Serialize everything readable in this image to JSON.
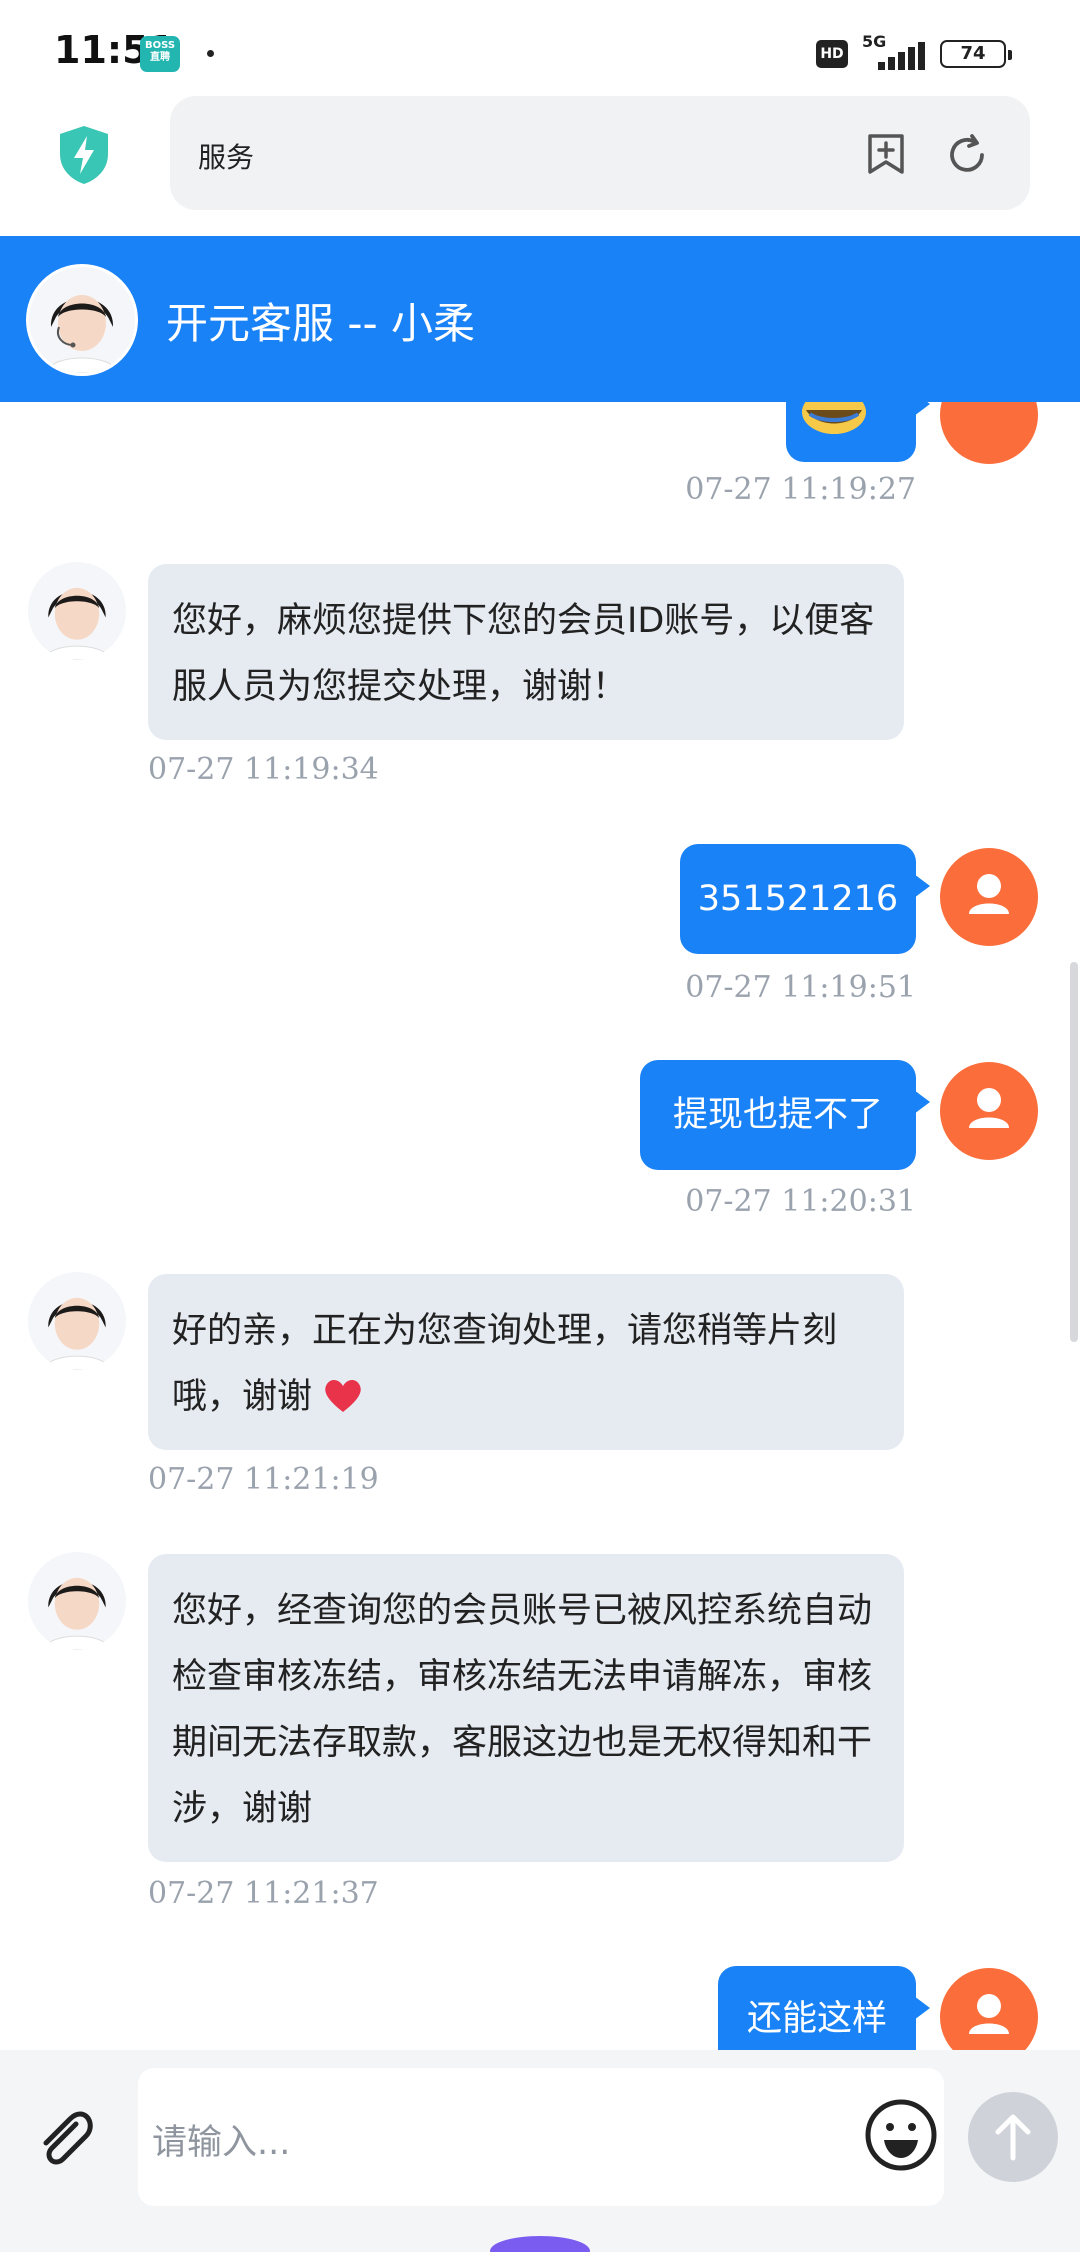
{
  "status_bar": {
    "time": "11:51",
    "app_badge": "BOSS\n直聘",
    "hd": "HD",
    "network": "5G",
    "battery": "74"
  },
  "browser": {
    "url_text": "服务"
  },
  "chat": {
    "title": "开元客服 -- 小柔"
  },
  "messages": [
    {
      "side": "out",
      "text": "",
      "time": "07-27 11:19:27"
    },
    {
      "side": "in",
      "text": "您好，麻烦您提供下您的会员ID账号，以便客服人员为您提交处理，谢谢！",
      "time": "07-27 11:19:34"
    },
    {
      "side": "out",
      "text": "351521216",
      "time": "07-27 11:19:51"
    },
    {
      "side": "out",
      "text": "提现也提不了",
      "time": "07-27 11:20:31"
    },
    {
      "side": "in",
      "text": "好的亲，正在为您查询处理，请您稍等片刻哦，谢谢",
      "time": "07-27 11:21:19"
    },
    {
      "side": "in",
      "text": "您好，经查询您的会员账号已被风控系统自动检查审核冻结，审核冻结无法申请解冻，审核期间无法存取款，客服这边也是无权得知和干涉，谢谢",
      "time": "07-27 11:21:37"
    },
    {
      "side": "out",
      "text": "还能这样",
      "time": ""
    }
  ],
  "input": {
    "placeholder": "请输入..."
  },
  "colors": {
    "brand_blue": "#1a82f7",
    "user_avatar": "#fb6d3a",
    "bubble_in": "#e6ebf2",
    "timestamp": "#9aa2ad"
  },
  "icons": [
    "shield-icon",
    "bookmark-add-icon",
    "refresh-icon",
    "attach-icon",
    "emoji-icon",
    "send-arrow-icon",
    "user-icon",
    "heart-icon"
  ]
}
